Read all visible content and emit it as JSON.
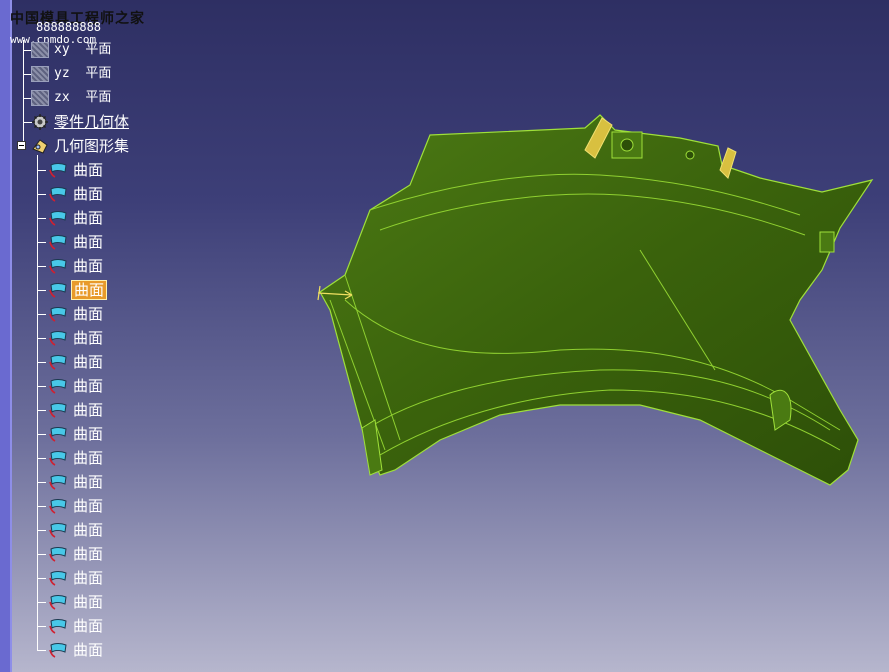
{
  "watermark": {
    "line1": "中国模具工程师之家",
    "line2": "888888888",
    "line3": "www.cnmdo.com"
  },
  "tree": {
    "planes": [
      {
        "name": "xy",
        "suffix": "平面"
      },
      {
        "name": "yz",
        "suffix": "平面"
      },
      {
        "name": "zx",
        "suffix": "平面"
      }
    ],
    "part_body": "零件几何体",
    "geometric_set": "几何图形集",
    "surfaces": [
      {
        "label": "曲面",
        "selected": false
      },
      {
        "label": "曲面",
        "selected": false
      },
      {
        "label": "曲面",
        "selected": false
      },
      {
        "label": "曲面",
        "selected": false
      },
      {
        "label": "曲面",
        "selected": false
      },
      {
        "label": "曲面",
        "selected": true
      },
      {
        "label": "曲面",
        "selected": false
      },
      {
        "label": "曲面",
        "selected": false
      },
      {
        "label": "曲面",
        "selected": false
      },
      {
        "label": "曲面",
        "selected": false
      },
      {
        "label": "曲面",
        "selected": false
      },
      {
        "label": "曲面",
        "selected": false
      },
      {
        "label": "曲面",
        "selected": false
      },
      {
        "label": "曲面",
        "selected": false
      },
      {
        "label": "曲面",
        "selected": false
      },
      {
        "label": "曲面",
        "selected": false
      },
      {
        "label": "曲面",
        "selected": false
      },
      {
        "label": "曲面",
        "selected": false
      },
      {
        "label": "曲面",
        "selected": false
      },
      {
        "label": "曲面",
        "selected": false
      },
      {
        "label": "曲面",
        "selected": false
      }
    ]
  },
  "colors": {
    "part_fill": "#3f6a10",
    "part_edge": "#9fe03a",
    "selection": "#e89a2a",
    "highlight": "#f0d040"
  }
}
